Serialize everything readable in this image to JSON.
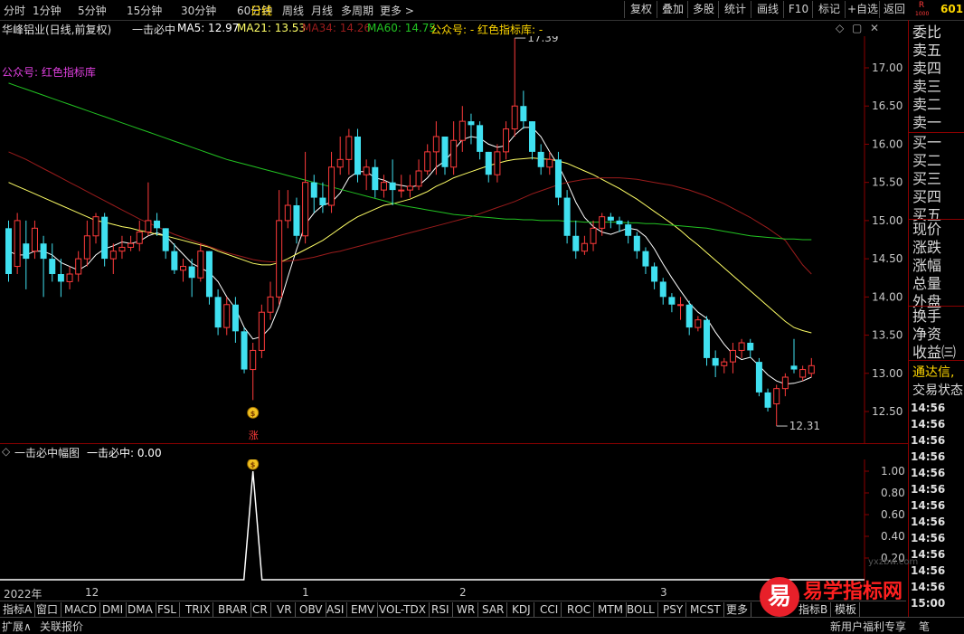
{
  "toolbar": {
    "periods": [
      "分时",
      "1分钟",
      "5分钟",
      "15分钟",
      "30分钟",
      "60分钟",
      "日线",
      "周线",
      "月线",
      "多周期",
      "更多 >"
    ],
    "active_period": "日线",
    "right_buttons": [
      "复权",
      "叠加",
      "多股",
      "统计",
      "画线",
      "F10",
      "标记",
      "+自选",
      "返回"
    ],
    "corner_code": "601",
    "corner_badge_top": "R",
    "corner_badge_bottom": "1000"
  },
  "infobar": {
    "stock": "华峰铝业(日线,前复权)",
    "indicator": "一击必中",
    "ma5": "MA5: 12.97",
    "ma21": "MA21: 13.53",
    "ma34": "MA34: 14.26",
    "ma60": "MA60: 14.75",
    "note": "公众号: - 红色指标库: -",
    "chart_label": "公众号: 红色指标库",
    "high_label": "17.39",
    "low_label": "12.31",
    "signal_marker": "涨"
  },
  "main_axis": {
    "ticks": [
      "17.00",
      "16.50",
      "16.00",
      "15.50",
      "15.00",
      "14.50",
      "14.00",
      "13.50",
      "13.00",
      "12.50"
    ]
  },
  "subchart": {
    "title": "一击必中幅图",
    "value": "一击必中: 0.00",
    "ticks": [
      "1.00",
      "0.80",
      "0.60",
      "0.40",
      "0.20"
    ]
  },
  "xaxis": {
    "labels": [
      "2022年",
      "12",
      "1",
      "2",
      "3"
    ]
  },
  "tabs": [
    "指标A",
    "窗口",
    "MACD",
    "DMI",
    "DMA",
    "FSL",
    "TRIX",
    "BRAR",
    "CR",
    "VR",
    "OBV",
    "ASI",
    "EMV",
    "VOL-TDX",
    "RSI",
    "WR",
    "SAR",
    "KDJ",
    "CCI",
    "ROC",
    "MTM",
    "BOLL",
    "PSY",
    "MCST",
    "更多",
    "指标B",
    "模板"
  ],
  "bottombar": {
    "expand": "扩展∧",
    "related": "关联报价",
    "news": "新用户福利专享",
    "pen": "笔"
  },
  "rightpanel": {
    "labels": [
      "委比",
      "卖五",
      "卖四",
      "卖三",
      "卖二",
      "卖一",
      "买一",
      "买二",
      "买三",
      "买四",
      "买五",
      "现价",
      "涨跌",
      "涨幅",
      "总量",
      "外盘",
      "换手",
      "净资",
      "收益㈢"
    ],
    "links": [
      "通达信,",
      "交易状态"
    ],
    "times": [
      "14:56",
      "14:56",
      "14:56",
      "14:56",
      "14:56",
      "14:56",
      "14:56",
      "14:56",
      "14:56",
      "14:56",
      "14:56",
      "14:56",
      "15:00"
    ]
  },
  "watermark": {
    "logo": "易",
    "text": "易学指标网",
    "url": "yxzbw.com"
  },
  "colors": {
    "up": "#ff3b3b",
    "down": "#40e0f0",
    "ma5": "#ffffff",
    "ma21": "#ffff66",
    "ma34": "#9b1c1c",
    "ma60": "#22c322",
    "frame": "#8b0000"
  },
  "chart_data": {
    "type": "candlestick",
    "ylim": [
      12.2,
      17.5
    ],
    "candles": [
      {
        "o": 14.9,
        "c": 14.3,
        "h": 15.0,
        "l": 14.2
      },
      {
        "o": 14.4,
        "c": 15.0,
        "h": 15.1,
        "l": 14.3
      },
      {
        "o": 14.7,
        "c": 14.5,
        "h": 15.0,
        "l": 14.1
      },
      {
        "o": 14.6,
        "c": 14.9,
        "h": 15.0,
        "l": 14.5
      },
      {
        "o": 14.7,
        "c": 14.5,
        "h": 14.8,
        "l": 14.0
      },
      {
        "o": 14.5,
        "c": 14.3,
        "h": 14.7,
        "l": 14.2
      },
      {
        "o": 14.3,
        "c": 14.2,
        "h": 14.5,
        "l": 14.0
      },
      {
        "o": 14.2,
        "c": 14.3,
        "h": 14.4,
        "l": 14.1
      },
      {
        "o": 14.3,
        "c": 14.5,
        "h": 14.6,
        "l": 14.2
      },
      {
        "o": 14.5,
        "c": 14.8,
        "h": 15.0,
        "l": 14.4
      },
      {
        "o": 14.8,
        "c": 15.05,
        "h": 15.1,
        "l": 14.7
      },
      {
        "o": 15.05,
        "c": 14.5,
        "h": 15.1,
        "l": 14.4
      },
      {
        "o": 14.5,
        "c": 14.6,
        "h": 14.7,
        "l": 14.3
      },
      {
        "o": 14.6,
        "c": 14.65,
        "h": 14.8,
        "l": 14.5
      },
      {
        "o": 14.65,
        "c": 14.7,
        "h": 14.8,
        "l": 14.6
      },
      {
        "o": 14.7,
        "c": 14.85,
        "h": 15.0,
        "l": 14.6
      },
      {
        "o": 14.85,
        "c": 15.0,
        "h": 15.5,
        "l": 14.8
      },
      {
        "o": 15.0,
        "c": 14.9,
        "h": 15.1,
        "l": 14.8
      },
      {
        "o": 14.9,
        "c": 14.6,
        "h": 14.9,
        "l": 14.5
      },
      {
        "o": 14.6,
        "c": 14.35,
        "h": 14.7,
        "l": 14.3
      },
      {
        "o": 14.35,
        "c": 14.4,
        "h": 14.5,
        "l": 14.2
      },
      {
        "o": 14.4,
        "c": 14.25,
        "h": 14.5,
        "l": 14.0
      },
      {
        "o": 14.25,
        "c": 14.6,
        "h": 14.7,
        "l": 14.2
      },
      {
        "o": 14.6,
        "c": 14.0,
        "h": 14.6,
        "l": 13.9
      },
      {
        "o": 14.0,
        "c": 13.6,
        "h": 14.1,
        "l": 13.5
      },
      {
        "o": 13.6,
        "c": 13.9,
        "h": 14.0,
        "l": 13.5
      },
      {
        "o": 13.9,
        "c": 13.55,
        "h": 14.0,
        "l": 13.4
      },
      {
        "o": 13.55,
        "c": 13.05,
        "h": 13.6,
        "l": 13.0
      },
      {
        "o": 13.05,
        "c": 13.3,
        "h": 13.4,
        "l": 12.65
      },
      {
        "o": 13.3,
        "c": 13.8,
        "h": 13.9,
        "l": 13.2
      },
      {
        "o": 13.8,
        "c": 14.0,
        "h": 14.2,
        "l": 13.7
      },
      {
        "o": 14.0,
        "c": 15.0,
        "h": 15.4,
        "l": 13.9
      },
      {
        "o": 15.0,
        "c": 15.2,
        "h": 15.4,
        "l": 14.9
      },
      {
        "o": 15.2,
        "c": 14.8,
        "h": 15.3,
        "l": 14.7
      },
      {
        "o": 14.8,
        "c": 15.5,
        "h": 15.9,
        "l": 14.7
      },
      {
        "o": 15.5,
        "c": 15.3,
        "h": 15.6,
        "l": 15.1
      },
      {
        "o": 15.3,
        "c": 15.2,
        "h": 15.5,
        "l": 15.1
      },
      {
        "o": 15.2,
        "c": 15.7,
        "h": 15.9,
        "l": 15.1
      },
      {
        "o": 15.7,
        "c": 15.8,
        "h": 16.1,
        "l": 15.6
      },
      {
        "o": 15.8,
        "c": 16.1,
        "h": 16.2,
        "l": 15.6
      },
      {
        "o": 16.1,
        "c": 15.6,
        "h": 16.2,
        "l": 15.5
      },
      {
        "o": 15.6,
        "c": 15.7,
        "h": 15.8,
        "l": 15.4
      },
      {
        "o": 15.7,
        "c": 15.4,
        "h": 15.8,
        "l": 15.3
      },
      {
        "o": 15.4,
        "c": 15.5,
        "h": 15.6,
        "l": 15.3
      },
      {
        "o": 15.5,
        "c": 15.4,
        "h": 15.8,
        "l": 15.2
      },
      {
        "o": 15.4,
        "c": 15.4,
        "h": 15.6,
        "l": 15.3
      },
      {
        "o": 15.4,
        "c": 15.45,
        "h": 15.6,
        "l": 15.3
      },
      {
        "o": 15.45,
        "c": 15.65,
        "h": 15.8,
        "l": 15.4
      },
      {
        "o": 15.65,
        "c": 15.9,
        "h": 16.0,
        "l": 15.6
      },
      {
        "o": 15.9,
        "c": 16.1,
        "h": 16.3,
        "l": 15.6
      },
      {
        "o": 16.1,
        "c": 15.7,
        "h": 16.1,
        "l": 15.6
      },
      {
        "o": 15.7,
        "c": 16.05,
        "h": 16.3,
        "l": 15.6
      },
      {
        "o": 16.05,
        "c": 16.3,
        "h": 16.5,
        "l": 15.9
      },
      {
        "o": 16.3,
        "c": 16.25,
        "h": 16.4,
        "l": 16.0
      },
      {
        "o": 16.25,
        "c": 15.9,
        "h": 16.3,
        "l": 15.8
      },
      {
        "o": 15.9,
        "c": 15.6,
        "h": 15.9,
        "l": 15.5
      },
      {
        "o": 15.6,
        "c": 15.9,
        "h": 16.0,
        "l": 15.5
      },
      {
        "o": 15.9,
        "c": 16.2,
        "h": 16.3,
        "l": 15.8
      },
      {
        "o": 16.2,
        "c": 16.5,
        "h": 17.39,
        "l": 16.1
      },
      {
        "o": 16.5,
        "c": 16.3,
        "h": 16.7,
        "l": 16.2
      },
      {
        "o": 16.3,
        "c": 15.9,
        "h": 16.3,
        "l": 15.8
      },
      {
        "o": 15.9,
        "c": 15.7,
        "h": 16.0,
        "l": 15.6
      },
      {
        "o": 15.7,
        "c": 15.8,
        "h": 15.9,
        "l": 15.6
      },
      {
        "o": 15.8,
        "c": 15.3,
        "h": 15.9,
        "l": 15.2
      },
      {
        "o": 15.3,
        "c": 14.8,
        "h": 15.4,
        "l": 14.7
      },
      {
        "o": 14.8,
        "c": 14.6,
        "h": 15.0,
        "l": 14.5
      },
      {
        "o": 14.6,
        "c": 14.7,
        "h": 14.8,
        "l": 14.55
      },
      {
        "o": 14.7,
        "c": 14.9,
        "h": 15.0,
        "l": 14.6
      },
      {
        "o": 14.9,
        "c": 15.05,
        "h": 15.1,
        "l": 14.8
      },
      {
        "o": 15.05,
        "c": 15.0,
        "h": 15.1,
        "l": 14.9
      },
      {
        "o": 15.0,
        "c": 14.95,
        "h": 15.05,
        "l": 14.85
      },
      {
        "o": 14.95,
        "c": 14.8,
        "h": 15.0,
        "l": 14.7
      },
      {
        "o": 14.8,
        "c": 14.6,
        "h": 14.85,
        "l": 14.5
      },
      {
        "o": 14.6,
        "c": 14.4,
        "h": 14.65,
        "l": 14.3
      },
      {
        "o": 14.4,
        "c": 14.2,
        "h": 14.45,
        "l": 14.1
      },
      {
        "o": 14.2,
        "c": 14.0,
        "h": 14.25,
        "l": 13.9
      },
      {
        "o": 14.0,
        "c": 13.9,
        "h": 14.05,
        "l": 13.8
      },
      {
        "o": 13.9,
        "c": 13.9,
        "h": 14.0,
        "l": 13.7
      },
      {
        "o": 13.9,
        "c": 13.6,
        "h": 13.95,
        "l": 13.5
      },
      {
        "o": 13.6,
        "c": 13.7,
        "h": 13.75,
        "l": 13.55
      },
      {
        "o": 13.7,
        "c": 13.2,
        "h": 13.75,
        "l": 13.1
      },
      {
        "o": 13.2,
        "c": 13.1,
        "h": 13.3,
        "l": 12.95
      },
      {
        "o": 13.1,
        "c": 13.15,
        "h": 13.2,
        "l": 13.0
      },
      {
        "o": 13.15,
        "c": 13.3,
        "h": 13.4,
        "l": 13.0
      },
      {
        "o": 13.3,
        "c": 13.4,
        "h": 13.45,
        "l": 13.2
      },
      {
        "o": 13.4,
        "c": 13.3,
        "h": 13.45,
        "l": 13.2
      },
      {
        "o": 13.15,
        "c": 12.75,
        "h": 13.2,
        "l": 12.7
      },
      {
        "o": 12.75,
        "c": 12.55,
        "h": 12.8,
        "l": 12.5
      },
      {
        "o": 12.6,
        "c": 12.8,
        "h": 12.85,
        "l": 12.31
      },
      {
        "o": 12.8,
        "c": 12.95,
        "h": 13.0,
        "l": 12.7
      },
      {
        "o": 13.1,
        "c": 13.05,
        "h": 13.45,
        "l": 13.0
      },
      {
        "o": 12.95,
        "c": 13.05,
        "h": 13.1,
        "l": 12.9
      },
      {
        "o": 13.0,
        "c": 13.1,
        "h": 13.2,
        "l": 12.95
      }
    ],
    "ma_lines": [
      {
        "name": "MA5",
        "values": [
          14.6,
          14.55,
          14.55,
          14.6,
          14.6,
          14.55,
          14.45,
          14.4,
          14.35,
          14.42,
          14.55,
          14.63,
          14.67,
          14.72,
          14.7,
          14.73,
          14.8,
          14.84,
          14.8,
          14.68,
          14.56,
          14.44,
          14.38,
          14.32,
          14.2,
          14.0,
          13.85,
          13.6,
          13.45,
          13.48,
          13.6,
          13.88,
          14.26,
          14.62,
          14.95,
          15.1,
          15.2,
          15.24,
          15.36,
          15.56,
          15.64,
          15.64,
          15.56,
          15.53,
          15.48,
          15.46,
          15.44,
          15.46,
          15.56,
          15.7,
          15.78,
          15.92,
          16.06,
          16.1,
          16.08,
          16.0,
          15.96,
          15.98,
          16.12,
          16.22,
          16.22,
          16.1,
          15.9,
          15.72,
          15.5,
          15.24,
          15.04,
          14.92,
          14.85,
          14.82,
          14.86,
          14.9,
          14.88,
          14.79,
          14.63,
          14.43,
          14.25,
          14.08,
          13.92,
          13.8,
          13.72,
          13.54,
          13.38,
          13.25,
          13.18,
          13.21,
          13.1,
          12.98,
          12.9,
          12.86,
          12.87,
          12.9,
          12.95
        ]
      },
      {
        "name": "MA21",
        "values": [
          15.5,
          15.45,
          15.4,
          15.35,
          15.3,
          15.25,
          15.2,
          15.15,
          15.1,
          15.05,
          15.0,
          14.98,
          14.95,
          14.92,
          14.9,
          14.87,
          14.85,
          14.82,
          14.8,
          14.77,
          14.74,
          14.71,
          14.68,
          14.65,
          14.6,
          14.56,
          14.52,
          14.48,
          14.44,
          14.42,
          14.42,
          14.45,
          14.5,
          14.56,
          14.62,
          14.68,
          14.74,
          14.82,
          14.9,
          14.98,
          15.05,
          15.1,
          15.15,
          15.2,
          15.22,
          15.25,
          15.28,
          15.33,
          15.38,
          15.45,
          15.5,
          15.56,
          15.6,
          15.64,
          15.68,
          15.72,
          15.75,
          15.78,
          15.8,
          15.81,
          15.82,
          15.81,
          15.8,
          15.78,
          15.75,
          15.7,
          15.65,
          15.6,
          15.54,
          15.48,
          15.42,
          15.35,
          15.28,
          15.2,
          15.12,
          15.04,
          14.96,
          14.87,
          14.77,
          14.68,
          14.58,
          14.48,
          14.38,
          14.28,
          14.18,
          14.08,
          13.98,
          13.88,
          13.78,
          13.68,
          13.6,
          13.56,
          13.53
        ]
      },
      {
        "name": "MA34",
        "values": [
          15.9,
          15.85,
          15.8,
          15.74,
          15.68,
          15.62,
          15.56,
          15.5,
          15.44,
          15.38,
          15.32,
          15.26,
          15.2,
          15.14,
          15.08,
          15.02,
          14.97,
          14.92,
          14.87,
          14.82,
          14.78,
          14.74,
          14.7,
          14.66,
          14.62,
          14.58,
          14.55,
          14.52,
          14.49,
          14.47,
          14.46,
          14.46,
          14.47,
          14.48,
          14.5,
          14.52,
          14.55,
          14.58,
          14.6,
          14.63,
          14.66,
          14.69,
          14.72,
          14.75,
          14.78,
          14.81,
          14.84,
          14.87,
          14.9,
          14.93,
          14.96,
          14.99,
          15.02,
          15.05,
          15.09,
          15.13,
          15.17,
          15.21,
          15.25,
          15.3,
          15.35,
          15.39,
          15.43,
          15.47,
          15.5,
          15.52,
          15.54,
          15.55,
          15.56,
          15.56,
          15.56,
          15.55,
          15.54,
          15.52,
          15.5,
          15.48,
          15.46,
          15.43,
          15.4,
          15.36,
          15.32,
          15.27,
          15.22,
          15.16,
          15.1,
          15.04,
          14.97,
          14.9,
          14.82,
          14.74,
          14.58,
          14.42,
          14.3
        ]
      },
      {
        "name": "MA60",
        "values": [
          16.8,
          16.76,
          16.72,
          16.68,
          16.64,
          16.6,
          16.56,
          16.52,
          16.48,
          16.44,
          16.4,
          16.36,
          16.32,
          16.28,
          16.24,
          16.2,
          16.16,
          16.12,
          16.08,
          16.04,
          16.0,
          15.96,
          15.92,
          15.88,
          15.84,
          15.8,
          15.77,
          15.74,
          15.71,
          15.68,
          15.65,
          15.62,
          15.59,
          15.56,
          15.53,
          15.5,
          15.47,
          15.44,
          15.41,
          15.38,
          15.35,
          15.32,
          15.29,
          15.26,
          15.23,
          15.2,
          15.18,
          15.16,
          15.14,
          15.12,
          15.1,
          15.08,
          15.07,
          15.06,
          15.05,
          15.04,
          15.03,
          15.02,
          15.02,
          15.01,
          15.01,
          15.0,
          15.0,
          15.0,
          14.99,
          14.99,
          14.98,
          14.98,
          14.98,
          14.98,
          14.98,
          14.97,
          14.97,
          14.96,
          14.96,
          14.95,
          14.94,
          14.93,
          14.92,
          14.91,
          14.9,
          14.88,
          14.86,
          14.84,
          14.82,
          14.8,
          14.79,
          14.78,
          14.77,
          14.76,
          14.76,
          14.75,
          14.75
        ]
      }
    ],
    "signal_index": 28,
    "sub_series": {
      "name": "一击必中",
      "values_spike_index": 28,
      "ylim": [
        0,
        1.1
      ]
    }
  }
}
